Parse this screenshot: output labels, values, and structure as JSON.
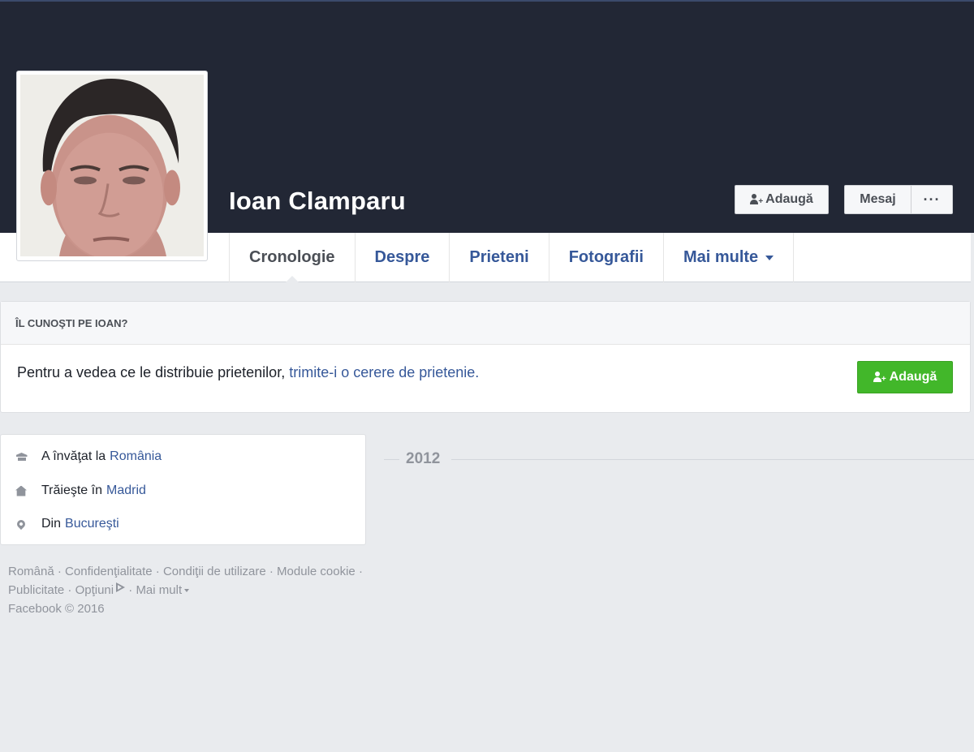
{
  "profile": {
    "name": "Ioan Clamparu"
  },
  "cover_actions": {
    "add_friend": "Adaugă",
    "message": "Mesaj",
    "more": "···"
  },
  "tabs": [
    {
      "label": "Cronologie",
      "active": true
    },
    {
      "label": "Despre",
      "active": false
    },
    {
      "label": "Prieteni",
      "active": false
    },
    {
      "label": "Fotografii",
      "active": false
    },
    {
      "label": "Mai multe",
      "active": false
    }
  ],
  "know_box": {
    "heading": "ÎL CUNOŞTI PE IOAN?",
    "text_prefix": "Pentru a vedea ce le distribuie prietenilor, ",
    "link_text": "trimite-i o cerere de prietenie.",
    "button": "Adaugă"
  },
  "intro": {
    "items": [
      {
        "icon": "school-icon",
        "text": "A învăţat la",
        "link": "România"
      },
      {
        "icon": "home-icon",
        "text": "Trăieşte în",
        "link": "Madrid"
      },
      {
        "icon": "location-pin-icon",
        "text": "Din",
        "link": "Bucureşti"
      }
    ]
  },
  "timeline": {
    "year": "2012"
  },
  "footer": {
    "links": [
      "Română",
      "Confidenţialitate",
      "Condiţii de utilizare",
      "Module cookie",
      "Publicitate",
      "Opţiuni",
      "Mai mult"
    ],
    "copyright": "Facebook © 2016",
    "separator": " · "
  },
  "colors": {
    "cover": "#222735",
    "link": "#365899",
    "add_green": "#42b72a",
    "page_bg": "#e9ebee"
  }
}
